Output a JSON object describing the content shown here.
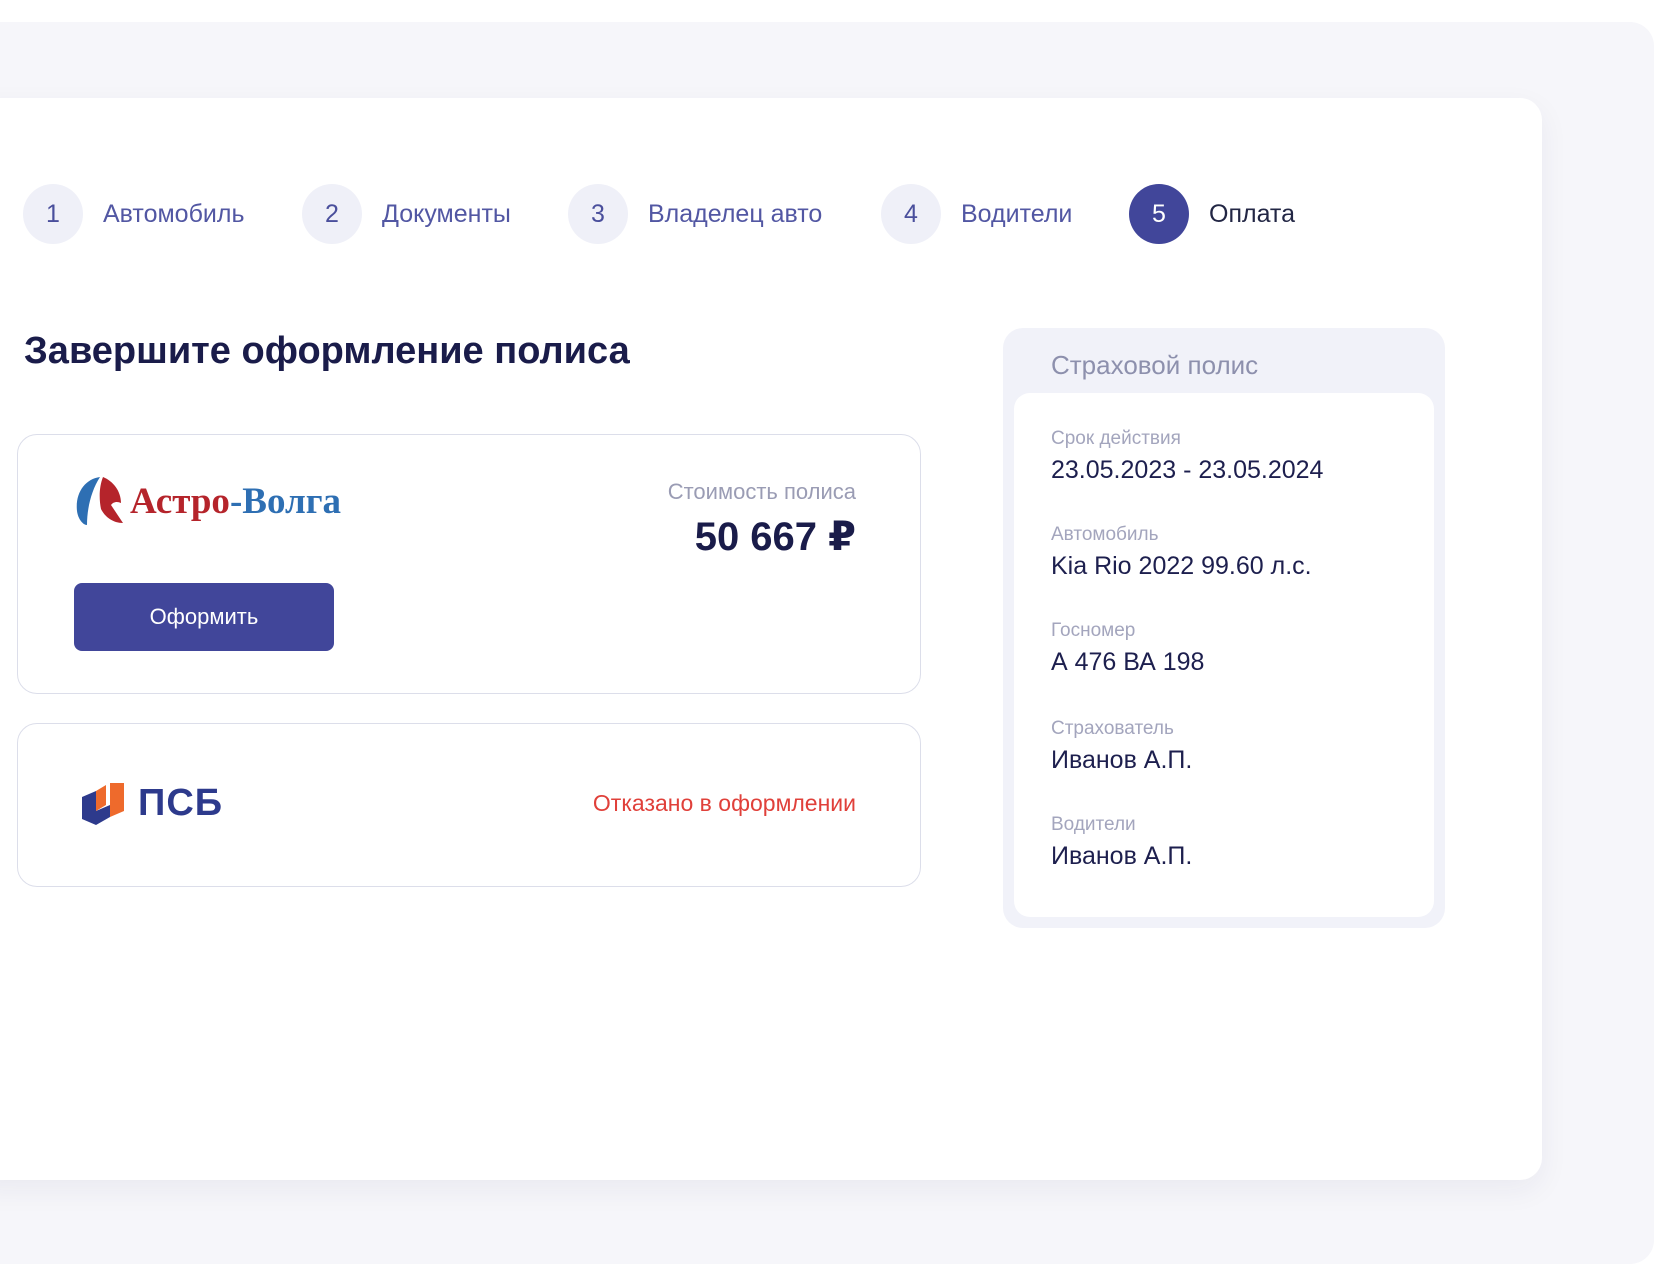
{
  "stepper": {
    "steps": [
      {
        "num": "1",
        "label": "Автомобиль"
      },
      {
        "num": "2",
        "label": "Документы"
      },
      {
        "num": "3",
        "label": "Владелец авто"
      },
      {
        "num": "4",
        "label": "Водители"
      },
      {
        "num": "5",
        "label": "Оплата"
      }
    ],
    "active_step": 5
  },
  "main": {
    "title": "Завершите оформление полиса",
    "offers": [
      {
        "insurer": "Астро-Волга",
        "insurer_parts": [
          "Астро",
          "-Волга"
        ],
        "price_label": "Стоимость полиса",
        "price": "50 667 ₽",
        "button_label": "Оформить"
      },
      {
        "insurer": "ПСБ",
        "status": "Отказано в оформлении"
      }
    ]
  },
  "summary": {
    "title": "Страховой полис",
    "fields": [
      {
        "label": "Срок действия",
        "value": "23.05.2023 - 23.05.2024"
      },
      {
        "label": "Автомобиль",
        "value": "Kia Rio 2022 99.60 л.с."
      },
      {
        "label": "Госномер",
        "value": "А 476 ВА 198"
      },
      {
        "label": "Страхователь",
        "value": "Иванов А.П."
      },
      {
        "label": "Водители",
        "value": "Иванов А.П."
      }
    ]
  },
  "colors": {
    "accent": "#41469a",
    "error": "#e0403a",
    "astro_red": "#b5242b",
    "astro_blue": "#2e6fb3",
    "psb_orange": "#ee6a2c",
    "psb_blue": "#2d3a8c"
  }
}
